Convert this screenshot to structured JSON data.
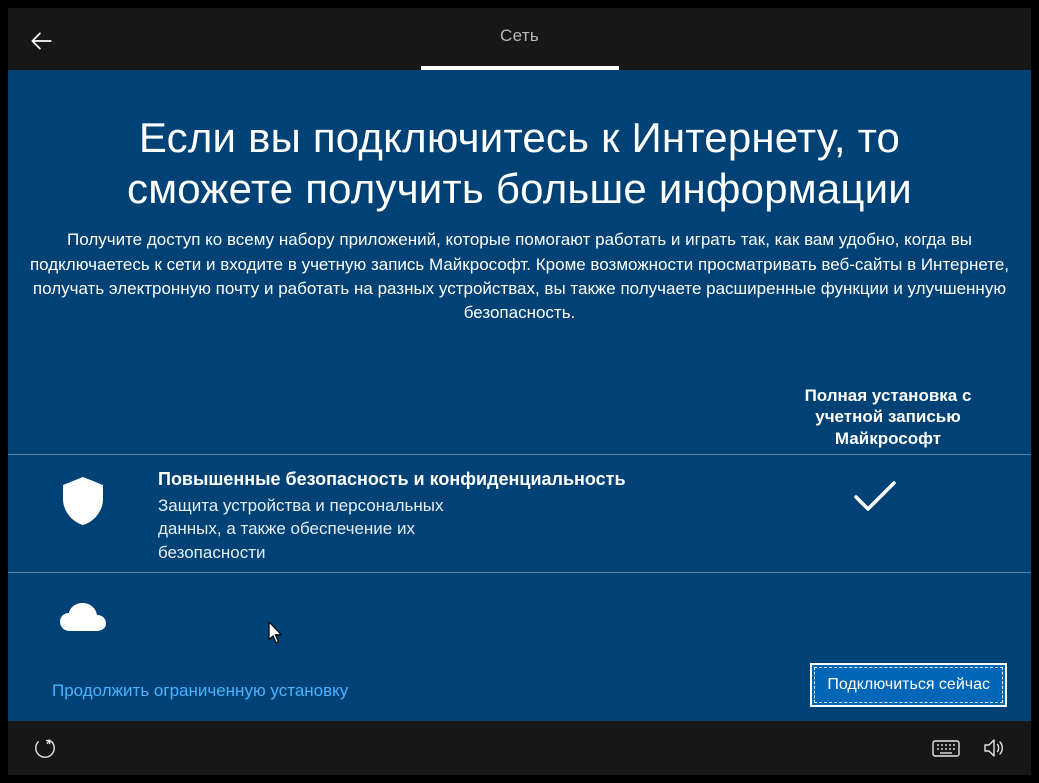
{
  "header": {
    "tab_label": "Сеть"
  },
  "main": {
    "title": "Если вы подключитесь к Интернету, то сможете получить больше информации",
    "subtitle": "Получите доступ ко всему набору приложений, которые помогают работать и играть так, как вам удобно, когда вы подключаетесь к сети и входите в учетную запись Майкрософт. Кроме возможности просматривать веб-сайты в Интернете, получать электронную почту и работать на разных устройствах, вы также получаете расширенные функции и улучшенную безопасность.",
    "column_header": "Полная установка с учетной записью Майкрософт",
    "rows": [
      {
        "icon": "shield-icon",
        "heading": "Повышенные безопасность и конфиденциальность",
        "desc": "Защита устройства и персональных данных, а также обеспечение их безопасности",
        "checked": true
      },
      {
        "icon": "cloud-icon",
        "heading": "",
        "desc": "",
        "checked": false
      }
    ]
  },
  "footer": {
    "limited_link": "Продолжить ограниченную установку",
    "connect_button": "Подключиться сейчас"
  }
}
